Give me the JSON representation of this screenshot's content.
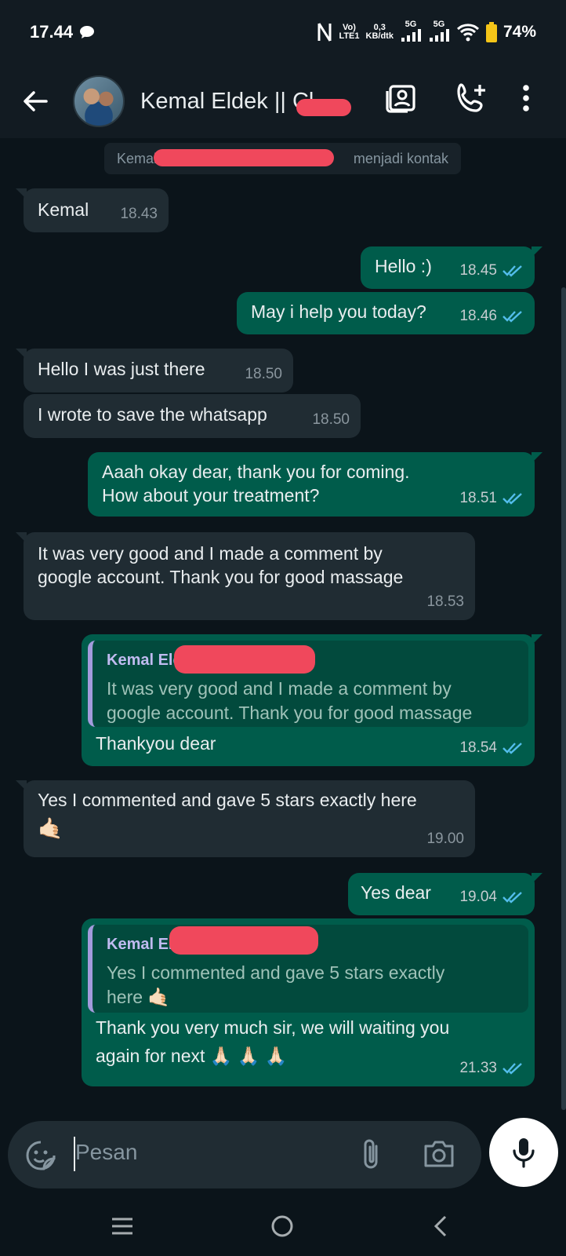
{
  "status_bar": {
    "time": "17.44",
    "volte_top": "Vo)",
    "volte_bottom": "LTE1",
    "speed_top": "0,3",
    "speed_bottom": "KB/dtk",
    "net1": "5G",
    "net2": "5G",
    "battery": "74%"
  },
  "header": {
    "contact_name": "Kemal Eldek || Cl"
  },
  "system_notice": {
    "prefix": "Kemal",
    "suffix": "menjadi kontak"
  },
  "messages": [
    {
      "dir": "in",
      "text": "Kemal",
      "time": "18.43"
    },
    {
      "dir": "out",
      "text": "Hello :)",
      "time": "18.45"
    },
    {
      "dir": "out",
      "text": "May i help you today?",
      "time": "18.46"
    },
    {
      "dir": "in",
      "text": "Hello I was just there",
      "time": "18.50"
    },
    {
      "dir": "in",
      "text": "I wrote to save the whatsapp",
      "time": "18.50"
    },
    {
      "dir": "out",
      "line1": "Aaah okay dear, thank you for coming.",
      "line2": "How about your treatment?",
      "time": "18.51"
    },
    {
      "dir": "in",
      "line1": "It was very good and I made a comment by",
      "line2": "google account. Thank you for good massage",
      "time": "18.53"
    },
    {
      "dir": "out",
      "quote_name": "Kemal Eld",
      "quote_line1": "It was very good and I made a comment by",
      "quote_line2": "google account. Thank you for good massage",
      "text": "Thankyou dear",
      "time": "18.54"
    },
    {
      "dir": "in",
      "text": "Yes I commented and gave 5 stars exactly here",
      "emoji": "🤙🏻",
      "time": "19.00"
    },
    {
      "dir": "out",
      "text": "Yes dear",
      "time": "19.04"
    },
    {
      "dir": "out",
      "quote_name": "Kemal El",
      "quote_line1": "Yes I commented and gave 5 stars exactly",
      "quote_line2": "here 🤙🏻",
      "line1": "Thank you very much sir, we will waiting you",
      "line2": "again for next 🙏🏻 🙏🏻 🙏🏻",
      "time": "21.33"
    }
  ],
  "input": {
    "placeholder": "Pesan"
  },
  "colors": {
    "background": "#0b141a",
    "incoming": "#202c33",
    "outgoing": "#005c4b",
    "read_ticks": "#53bdeb",
    "redaction": "#f0485c"
  },
  "icons": [
    "chat-bubble-icon",
    "back-arrow-icon",
    "contact-card-icon",
    "add-call-icon",
    "more-vert-icon",
    "sticker-icon",
    "attach-icon",
    "camera-icon",
    "mic-icon",
    "nav-menu-icon",
    "nav-home-icon",
    "nav-back-icon"
  ]
}
